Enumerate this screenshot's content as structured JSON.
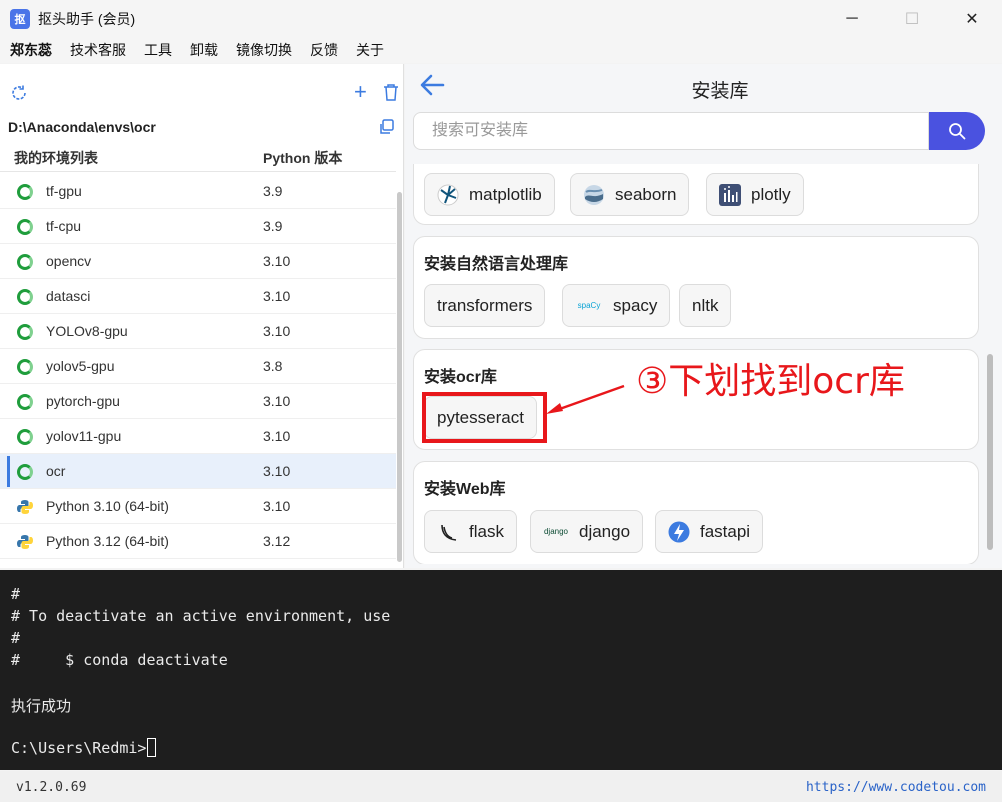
{
  "window": {
    "title": "抠头助手 (会员)",
    "app_icon_text": "抠"
  },
  "menu": {
    "items": [
      "郑东蕊",
      "技术客服",
      "工具",
      "卸载",
      "镜像切换",
      "反馈",
      "关于"
    ]
  },
  "env_panel": {
    "path": "D:\\Anaconda\\envs\\ocr",
    "header_name": "我的环境列表",
    "header_version": "Python 版本",
    "envs": [
      {
        "name": "tf-gpu",
        "version": "3.9",
        "icon": "conda-ring-icon"
      },
      {
        "name": "tf-cpu",
        "version": "3.9",
        "icon": "conda-ring-icon"
      },
      {
        "name": "opencv",
        "version": "3.10",
        "icon": "conda-ring-icon"
      },
      {
        "name": "datasci",
        "version": "3.10",
        "icon": "conda-ring-icon"
      },
      {
        "name": "YOLOv8-gpu",
        "version": "3.10",
        "icon": "conda-ring-icon"
      },
      {
        "name": "yolov5-gpu",
        "version": "3.8",
        "icon": "conda-ring-icon"
      },
      {
        "name": "pytorch-gpu",
        "version": "3.10",
        "icon": "conda-ring-icon"
      },
      {
        "name": "yolov11-gpu",
        "version": "3.10",
        "icon": "conda-ring-icon"
      },
      {
        "name": "ocr",
        "version": "3.10",
        "icon": "conda-ring-icon",
        "selected": true
      },
      {
        "name": "Python 3.10 (64-bit)",
        "version": "3.10",
        "icon": "python-logo-icon"
      },
      {
        "name": "Python 3.12 (64-bit)",
        "version": "3.12",
        "icon": "python-logo-icon"
      }
    ]
  },
  "lib_panel": {
    "title": "安装库",
    "search_placeholder": "搜索可安装库",
    "sections": [
      {
        "title": "",
        "packages": [
          "matplotlib",
          "seaborn",
          "plotly"
        ]
      },
      {
        "title": "安装自然语言处理库",
        "packages": [
          "transformers",
          "spacy",
          "nltk"
        ]
      },
      {
        "title": "安装ocr库",
        "packages": [
          "pytesseract"
        ]
      },
      {
        "title": "安装Web库",
        "packages": [
          "flask",
          "django",
          "fastapi"
        ]
      }
    ],
    "spacy_icon_text": "spaCy",
    "django_icon_text": "django"
  },
  "annotation": {
    "text": "③下划找到ocr库",
    "color": "#e8171b"
  },
  "terminal": {
    "lines": [
      "#",
      "# To deactivate an active environment, use",
      "#",
      "#     $ conda deactivate",
      "",
      "执行成功",
      "",
      "C:\\Users\\Redmi>"
    ]
  },
  "status": {
    "version": "v1.2.0.69",
    "website": "https://www.codetou.com"
  },
  "colors": {
    "accent": "#3c7be0",
    "search_button": "#4a52e0",
    "conda_green": "#1f9d3c",
    "terminal_bg": "#1e1e1e"
  }
}
